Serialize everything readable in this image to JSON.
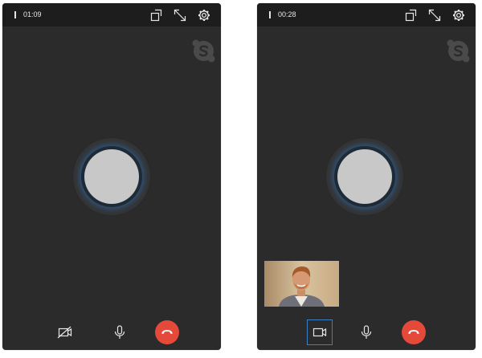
{
  "calls": [
    {
      "timer": "01:09",
      "video_state": "camera-off",
      "has_self_view": false,
      "icons": {
        "signal": "signal-strength-icon",
        "popout": "popout-window-icon",
        "fullscreen": "fullscreen-icon",
        "settings": "gear-icon",
        "logo": "skype-logo-icon",
        "camera": "camera-off-icon",
        "mic": "microphone-icon",
        "hangup": "hang-up-icon"
      }
    },
    {
      "timer": "00:28",
      "video_state": "camera-on",
      "has_self_view": true,
      "icons": {
        "signal": "signal-strength-icon",
        "popout": "popout-window-icon",
        "fullscreen": "fullscreen-icon",
        "settings": "gear-icon",
        "logo": "skype-logo-icon",
        "camera": "video-camera-icon",
        "mic": "microphone-icon",
        "hangup": "hang-up-icon"
      }
    }
  ],
  "colors": {
    "window_bg": "#2b2b2b",
    "titlebar_bg": "#1d1d1d",
    "icon": "#e6e6e6",
    "avatar": "#c8c8c8",
    "avatar_glow": "#2e78c8",
    "hangup": "#e5493a",
    "selected_outline": "#3b7fc4"
  }
}
